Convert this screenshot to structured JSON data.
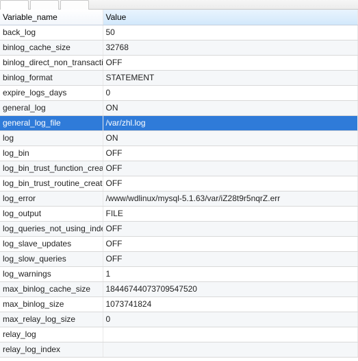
{
  "header": {
    "col_name": "Variable_name",
    "col_value": "Value"
  },
  "selected_index": 6,
  "rows": [
    {
      "name": "back_log",
      "value": "50"
    },
    {
      "name": "binlog_cache_size",
      "value": "32768"
    },
    {
      "name": "binlog_direct_non_transactional_updates",
      "value": "OFF"
    },
    {
      "name": "binlog_format",
      "value": "STATEMENT"
    },
    {
      "name": "expire_logs_days",
      "value": "0"
    },
    {
      "name": "general_log",
      "value": "ON"
    },
    {
      "name": "general_log_file",
      "value": "/var/zhl.log"
    },
    {
      "name": "log",
      "value": "ON"
    },
    {
      "name": "log_bin",
      "value": "OFF"
    },
    {
      "name": "log_bin_trust_function_creators",
      "value": "OFF"
    },
    {
      "name": "log_bin_trust_routine_creators",
      "value": "OFF"
    },
    {
      "name": "log_error",
      "value": "/www/wdlinux/mysql-5.1.63/var/iZ28t9r5nqrZ.err"
    },
    {
      "name": "log_output",
      "value": "FILE"
    },
    {
      "name": "log_queries_not_using_indexes",
      "value": "OFF"
    },
    {
      "name": "log_slave_updates",
      "value": "OFF"
    },
    {
      "name": "log_slow_queries",
      "value": "OFF"
    },
    {
      "name": "log_warnings",
      "value": "1"
    },
    {
      "name": "max_binlog_cache_size",
      "value": "18446744073709547520"
    },
    {
      "name": "max_binlog_size",
      "value": "1073741824"
    },
    {
      "name": "max_relay_log_size",
      "value": "0"
    },
    {
      "name": "relay_log",
      "value": ""
    },
    {
      "name": "relay_log_index",
      "value": ""
    }
  ]
}
